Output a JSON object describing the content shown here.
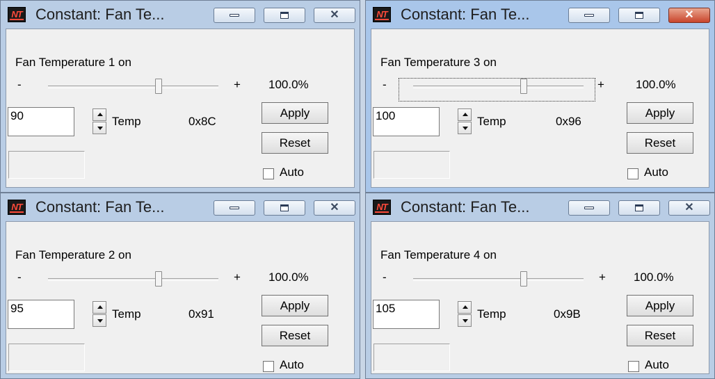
{
  "windows": [
    {
      "title": "Constant: Fan Te...",
      "label": "Fan Temperature 1 on",
      "slider_level": 0.65,
      "minus": "-",
      "plus": "+",
      "percent": "100.0%",
      "value": "90",
      "temp_label": "Temp",
      "hex": "0x8C",
      "apply": "Apply",
      "reset": "Reset",
      "auto": "Auto",
      "active": false
    },
    {
      "title": "Constant: Fan Te...",
      "label": "Fan Temperature 3 on",
      "slider_level": 0.65,
      "minus": "-",
      "plus": "+",
      "percent": "100.0%",
      "value": "100",
      "temp_label": "Temp",
      "hex": "0x96",
      "apply": "Apply",
      "reset": "Reset",
      "auto": "Auto",
      "active": true
    },
    {
      "title": "Constant: Fan Te...",
      "label": "Fan Temperature 2 on",
      "slider_level": 0.65,
      "minus": "-",
      "plus": "+",
      "percent": "100.0%",
      "value": "95",
      "temp_label": "Temp",
      "hex": "0x91",
      "apply": "Apply",
      "reset": "Reset",
      "auto": "Auto",
      "active": false
    },
    {
      "title": "Constant: Fan Te...",
      "label": "Fan Temperature 4 on",
      "slider_level": 0.65,
      "minus": "-",
      "plus": "+",
      "percent": "100.0%",
      "value": "105",
      "temp_label": "Temp",
      "hex": "0x9B",
      "apply": "Apply",
      "reset": "Reset",
      "auto": "Auto",
      "active": false
    }
  ],
  "icons": {
    "app": "nt-app-icon",
    "minimize": "minimize-icon",
    "maximize": "maximize-icon",
    "close": "close-icon",
    "spin_up": "spin-up-icon",
    "spin_down": "spin-down-icon"
  },
  "colors": {
    "window_frame": "#b9cde5",
    "active_frame": "#a9c6ea",
    "close_active": "#c9452c",
    "client_bg": "#f0f0f0",
    "logo_red": "#ff4a3a"
  }
}
